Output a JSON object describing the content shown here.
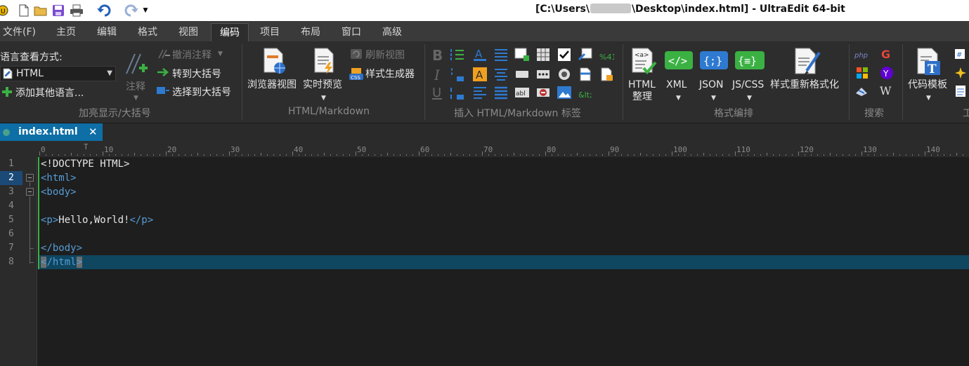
{
  "window": {
    "title_prefix": "[C:\\Users\\",
    "title_suffix": "\\Desktop\\index.html] - UltraEdit 64-bit"
  },
  "menu": {
    "tabs": [
      "文件(F)",
      "主页",
      "编辑",
      "格式",
      "视图",
      "编码",
      "项目",
      "布局",
      "窗口",
      "高级"
    ],
    "active": "编码"
  },
  "ribbon": {
    "group1": {
      "title": "加亮显示/大括号",
      "lang_label": "语言查看方式:",
      "lang_value": "HTML",
      "add_lang": "添加其他语言...",
      "comment": "注释",
      "uncomment": "撤消注释",
      "goto_brace": "转到大括号",
      "select_brace": "选择到大括号"
    },
    "group2": {
      "title": "HTML/Markdown",
      "browser_view": "浏览器视图",
      "live_preview": "实时预览",
      "refresh_view": "刷新视图",
      "style_builder": "样式生成器"
    },
    "group3": {
      "title": "插入 HTML/Markdown 标签"
    },
    "group4": {
      "title": "格式编排",
      "html_tidy_1": "HTML",
      "html_tidy_2": "整理",
      "xml": "XML",
      "json": "JSON",
      "jscss": "JS/CSS",
      "reformat": "样式重新格式化"
    },
    "group5": {
      "title": "搜索"
    },
    "group6": {
      "title": "工",
      "code_template": "代码模板"
    }
  },
  "document": {
    "tab_name": "index.html",
    "close": "✕"
  },
  "ruler": {
    "labels": [
      "0",
      "10",
      "20",
      "30",
      "40",
      "50",
      "60",
      "70",
      "80",
      "90",
      "100",
      "110",
      "120",
      "130",
      "140"
    ]
  },
  "editor": {
    "line_numbers": [
      "1",
      "2",
      "3",
      "4",
      "5",
      "6",
      "7",
      "8"
    ],
    "current_line": 8,
    "lines": {
      "l1": "<!DOCTYPE HTML>",
      "l2": "<html>",
      "l3": "<body>",
      "l5_open": "<p>",
      "l5_text": "Hello,World!",
      "l5_close": "</p>",
      "l7": "</body>",
      "l8_lt": "<",
      "l8_mid": "/html",
      "l8_gt": ">"
    }
  },
  "colors": {
    "accent": "#0e6ea6",
    "tag": "#569cd6",
    "current_line": "#0f4660",
    "modified_bar": "#3bb143"
  }
}
